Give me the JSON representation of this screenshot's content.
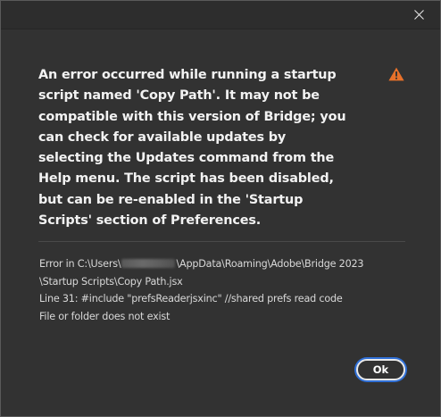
{
  "dialog": {
    "message": "An error occurred while running a startup script named 'Copy Path'.  It may not be compatible with this version of Bridge; you can check for available updates by selecting the Updates command from the Help menu.  The script has been disabled, but can be re-enabled in the 'Startup Scripts' section of Preferences.",
    "details": {
      "line1_prefix": "Error in C:\\Users\\",
      "line1_suffix": "\\AppData\\Roaming\\Adobe\\Bridge 2023",
      "line2": "\\Startup Scripts\\Copy Path.jsx",
      "line3": "Line 31: #include \"prefsReaderjsxinc\" //shared prefs read code",
      "line4": "File or folder does not exist"
    },
    "ok_label": "Ok",
    "icons": {
      "close": "close-icon",
      "warning": "warning-icon"
    },
    "colors": {
      "background": "#323232",
      "titlebar": "#2d2d2d",
      "warning": "#e8712a",
      "focus_ring": "#2f6fd6",
      "text": "#f2f2f2"
    }
  }
}
